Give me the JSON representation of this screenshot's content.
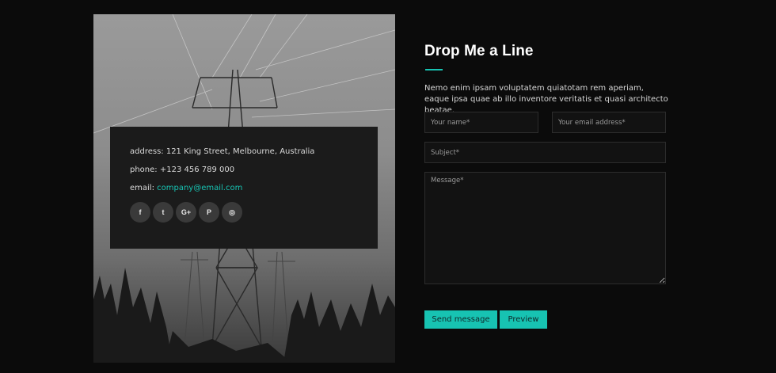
{
  "contact": {
    "address": "address: 121 King Street, Melbourne, Australia",
    "phone": "phone: +123 456 789 000",
    "email_label": "email: ",
    "email_value": "company@email.com"
  },
  "social": [
    {
      "icon": "facebook-icon",
      "glyph": "f"
    },
    {
      "icon": "twitter-icon",
      "glyph": "t"
    },
    {
      "icon": "google-plus-icon",
      "glyph": "G+"
    },
    {
      "icon": "pinterest-icon",
      "glyph": "P"
    },
    {
      "icon": "dribbble-icon",
      "glyph": "◎"
    }
  ],
  "form": {
    "title": "Drop Me a Line",
    "intro": "Nemo enim ipsam voluptatem quiatotam rem aperiam, eaque ipsa quae ab illo inventore veritatis et quasi architecto beatae.",
    "name_placeholder": "Your name*",
    "email_placeholder": "Your email address*",
    "subject_placeholder": "Subject*",
    "message_placeholder": "Message*",
    "send_label": "Send message",
    "preview_label": "Preview"
  },
  "colors": {
    "accent": "#17c3b2",
    "background": "#0b0b0b",
    "card": "#1b1b1b"
  }
}
